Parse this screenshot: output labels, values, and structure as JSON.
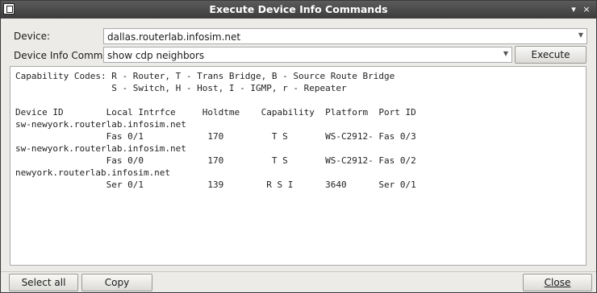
{
  "window": {
    "title": "Execute Device Info Commands",
    "minimize": "▾",
    "close": "×"
  },
  "device": {
    "label": "Device:",
    "value": "dallas.routerlab.infosim.net"
  },
  "command": {
    "label": "Device Info Command:",
    "value": "show cdp neighbors",
    "execute_label": "Execute"
  },
  "output": {
    "lines": [
      "Capability Codes: R - Router, T - Trans Bridge, B - Source Route Bridge",
      "                  S - Switch, H - Host, I - IGMP, r - Repeater",
      "",
      "Device ID        Local Intrfce     Holdtme    Capability  Platform  Port ID",
      "sw-newyork.routerlab.infosim.net",
      "                 Fas 0/1            170         T S       WS-C2912- Fas 0/3",
      "sw-newyork.routerlab.infosim.net",
      "                 Fas 0/0            170         T S       WS-C2912- Fas 0/2",
      "newyork.routerlab.infosim.net",
      "                 Ser 0/1            139        R S I      3640      Ser 0/1"
    ]
  },
  "footer": {
    "select_all": "Select all",
    "copy": "Copy",
    "close": "Close"
  }
}
